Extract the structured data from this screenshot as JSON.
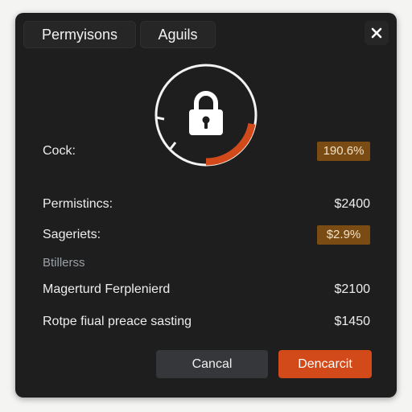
{
  "tabs": [
    {
      "label": "Permyisons"
    },
    {
      "label": "Aguils"
    }
  ],
  "icons": {
    "close": "close-icon",
    "lock": "lock-icon"
  },
  "dial": {
    "progress_fraction": 0.22
  },
  "rows": [
    {
      "label": "Cock:",
      "value": "190.6%",
      "style": "badge"
    },
    {
      "label": "Permistincs:",
      "value": "$2400",
      "style": "plain"
    },
    {
      "label": "Sageriets:",
      "value": "$2.9%",
      "style": "badge"
    },
    {
      "label": "Btillerss",
      "value": "",
      "style": "muted"
    },
    {
      "label": "Magerturd Ferplenierd",
      "value": "$2100",
      "style": "plain"
    },
    {
      "label": "Rotpe fiual preace sasting",
      "value": "$1450",
      "style": "plain"
    }
  ],
  "buttons": {
    "cancel": "Cancal",
    "confirm": "Dencarcit"
  },
  "colors": {
    "accent": "#d2491a",
    "badge": "#7a4b12",
    "panel": "#1e1e1f"
  }
}
